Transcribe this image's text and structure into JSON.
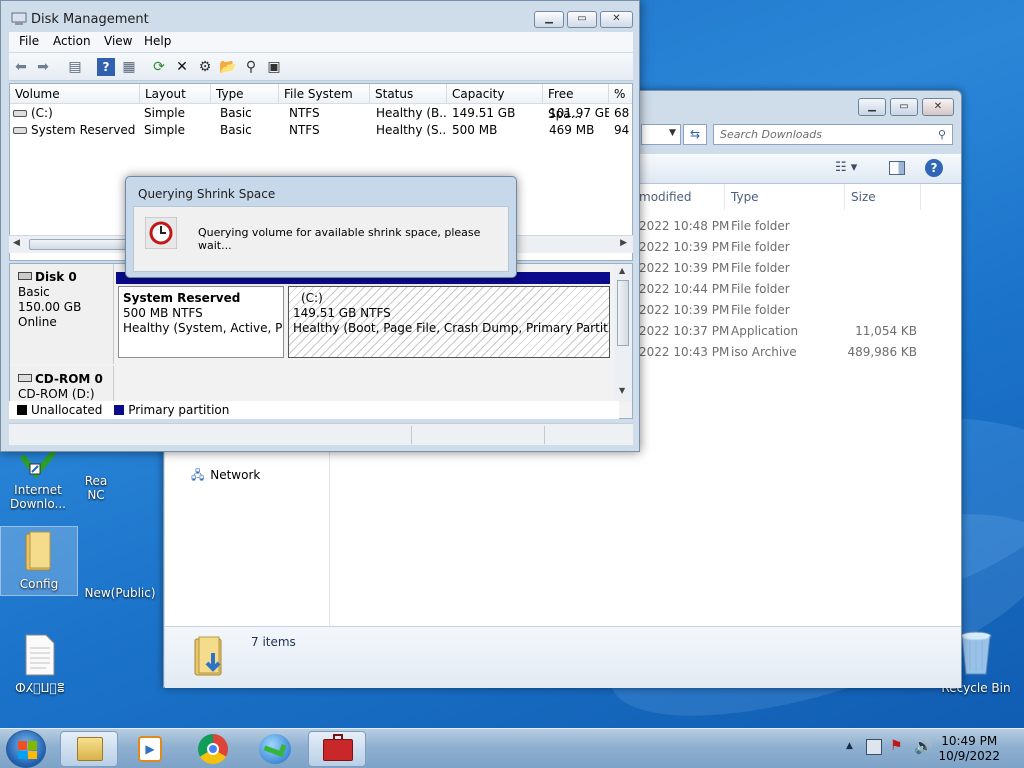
{
  "disk_management": {
    "title": "Disk Management",
    "menu": [
      "File",
      "Action",
      "View",
      "Help"
    ],
    "columns": [
      "Volume",
      "Layout",
      "Type",
      "File System",
      "Status",
      "Capacity",
      "Free Spa...",
      "% F"
    ],
    "volumes": [
      [
        "(C:)",
        "Simple",
        "Basic",
        "NTFS",
        "Healthy (B...",
        "149.51 GB",
        "101.97 GB",
        "68"
      ],
      [
        "System Reserved",
        "Simple",
        "Basic",
        "NTFS",
        "Healthy (S...",
        "500 MB",
        "469 MB",
        "94"
      ]
    ],
    "disk0": {
      "name": "Disk 0",
      "type": "Basic",
      "size": "150.00 GB",
      "state": "Online",
      "partitions": [
        {
          "name": "System Reserved",
          "size": "500 MB NTFS",
          "status": "Healthy (System, Active, Primary Partition)"
        },
        {
          "name": "(C:)",
          "size": "149.51 GB NTFS",
          "status": "Healthy (Boot, Page File, Crash Dump, Primary Partition)"
        }
      ]
    },
    "cdrom0": {
      "name": "CD-ROM 0",
      "drive": "CD-ROM (D:)"
    },
    "legend": {
      "unallocated": "Unallocated",
      "primary": "Primary partition"
    },
    "colors": {
      "partition_bar": "#0a0a8c",
      "unallocated": "#000000"
    }
  },
  "dialog": {
    "title": "Querying Shrink Space",
    "message": "Querying volume for available shrink space, please wait..."
  },
  "explorer": {
    "search_placeholder": "Search Downloads",
    "columns": [
      "modified",
      "Type",
      "Size"
    ],
    "files": [
      {
        "modified": "2022 10:48 PM",
        "type": "File folder",
        "size": ""
      },
      {
        "modified": "2022 10:39 PM",
        "type": "File folder",
        "size": ""
      },
      {
        "modified": "2022 10:39 PM",
        "type": "File folder",
        "size": ""
      },
      {
        "modified": "2022 10:44 PM",
        "type": "File folder",
        "size": ""
      },
      {
        "modified": "2022 10:39 PM",
        "type": "File folder",
        "size": ""
      },
      {
        "modified": "2022 10:37 PM",
        "type": "Application",
        "size": "11,054 KB"
      },
      {
        "modified": "2022 10:43 PM",
        "type": "iso Archive",
        "size": "489,986 KB"
      }
    ],
    "nav_network": "Network",
    "status_items": "7 items"
  },
  "desktop_icons": {
    "idm": "Internet Downlo...",
    "rea": "Rea NC",
    "config": "Config",
    "new_public": "New(Public)",
    "file": "ⵀⵃ⵿ⵡ⵿ⴻ",
    "recycle": "Recycle Bin"
  },
  "taskbar": {
    "time": "10:49 PM",
    "date": "10/9/2022"
  }
}
